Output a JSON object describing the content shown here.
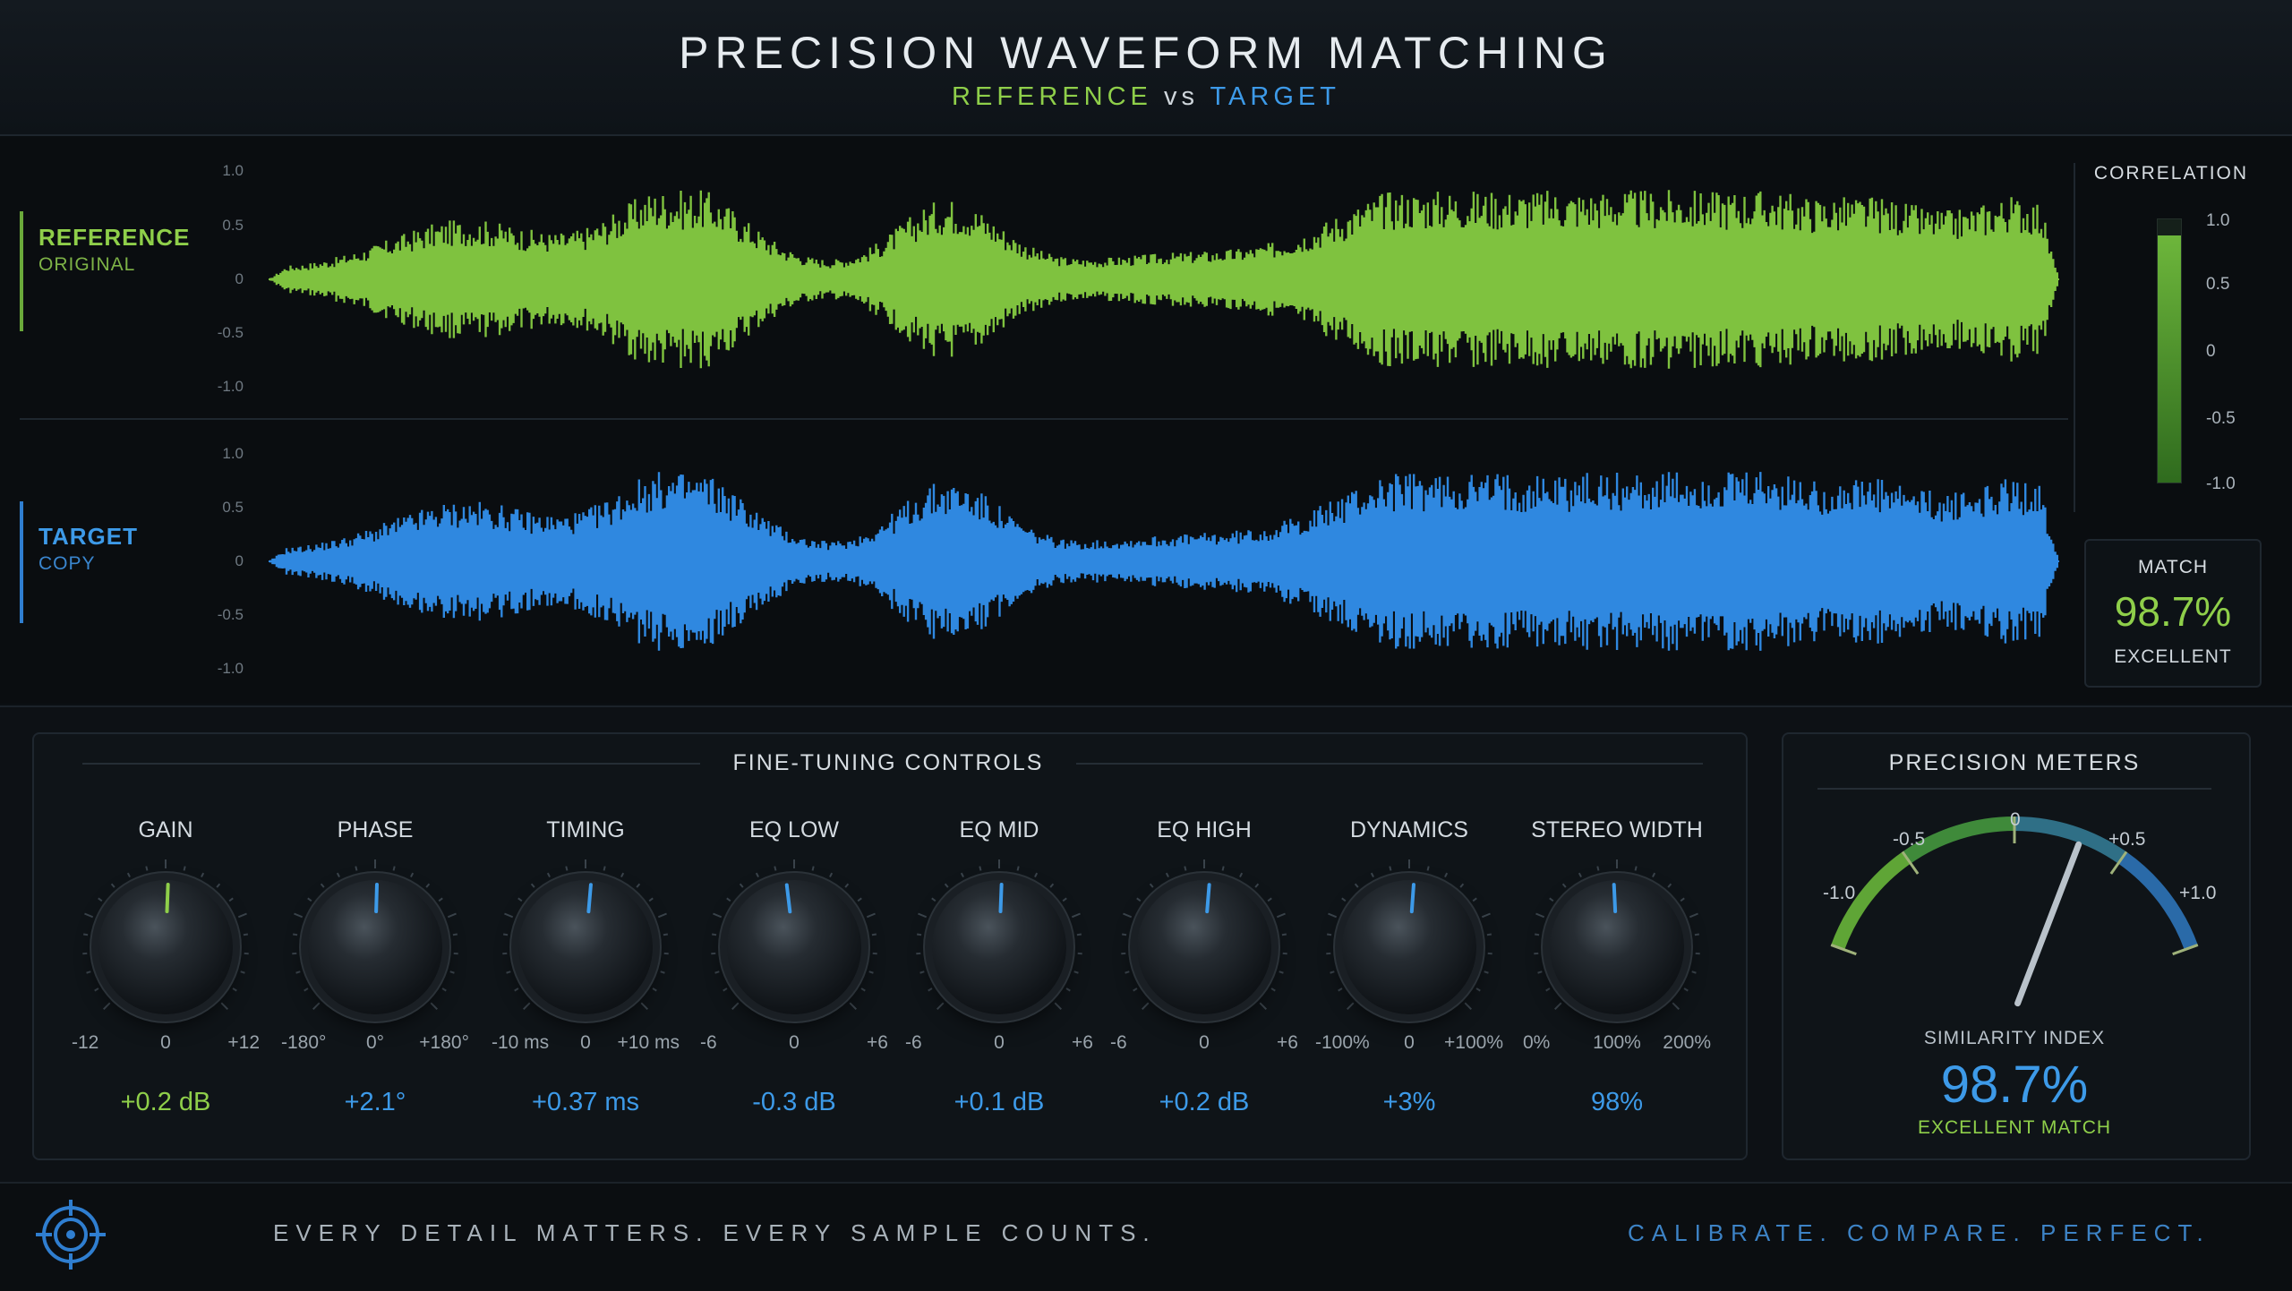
{
  "header": {
    "title": "PRECISION WAVEFORM MATCHING",
    "subtitle_reference": "REFERENCE",
    "subtitle_vs": "vs",
    "subtitle_target": "TARGET"
  },
  "tracks": [
    {
      "name": "REFERENCE",
      "sub": "ORIGINAL",
      "color": "#7fc23f"
    },
    {
      "name": "TARGET",
      "sub": "COPY",
      "color": "#2f88e0"
    }
  ],
  "amplitude_axis": [
    "1.0",
    "0.5",
    "0",
    "-0.5",
    "-1.0"
  ],
  "correlation": {
    "title": "CORRELATION",
    "ticks": [
      "1.0",
      "0.5",
      "0",
      "-0.5",
      "-1.0"
    ],
    "value": 0.88
  },
  "match": {
    "label": "MATCH",
    "value": "98.7%",
    "grade": "EXCELLENT"
  },
  "controls": {
    "title": "FINE-TUNING CONTROLS",
    "knobs": [
      {
        "label": "GAIN",
        "min": "-12",
        "mid": "0",
        "max": "+12",
        "value": "+0.2 dB",
        "level": 0.508,
        "color": "#8fcf4a"
      },
      {
        "label": "PHASE",
        "min": "-180°",
        "mid": "0°",
        "max": "+180°",
        "value": "+2.1°",
        "level": 0.506,
        "color": "#3d9ae8"
      },
      {
        "label": "TIMING",
        "min": "-10 ms",
        "mid": "0",
        "max": "+10 ms",
        "value": "+0.37 ms",
        "level": 0.518,
        "color": "#3d9ae8"
      },
      {
        "label": "EQ LOW",
        "min": "-6",
        "mid": "0",
        "max": "+6",
        "value": "-0.3 dB",
        "level": 0.475,
        "color": "#3d9ae8"
      },
      {
        "label": "EQ MID",
        "min": "-6",
        "mid": "0",
        "max": "+6",
        "value": "+0.1 dB",
        "level": 0.508,
        "color": "#3d9ae8"
      },
      {
        "label": "EQ HIGH",
        "min": "-6",
        "mid": "0",
        "max": "+6",
        "value": "+0.2 dB",
        "level": 0.517,
        "color": "#3d9ae8"
      },
      {
        "label": "DYNAMICS",
        "min": "-100%",
        "mid": "0",
        "max": "+100%",
        "value": "+3%",
        "level": 0.515,
        "color": "#3d9ae8"
      },
      {
        "label": "STEREO WIDTH",
        "min": "0%",
        "mid": "100%",
        "max": "200%",
        "value": "98%",
        "level": 0.49,
        "color": "#3d9ae8"
      }
    ]
  },
  "meters": {
    "title": "PRECISION METERS",
    "ticks": [
      "-1.0",
      "-0.5",
      "0",
      "+0.5",
      "+1.0"
    ],
    "needle_value": 0.3,
    "similarity_label": "SIMILARITY INDEX",
    "similarity_value": "98.7%",
    "similarity_grade": "EXCELLENT MATCH"
  },
  "footer": {
    "tagline_left": "EVERY DETAIL MATTERS. EVERY SAMPLE COUNTS.",
    "tagline_right": "CALIBRATE. COMPARE. PERFECT.",
    "logo_icon": "crosshair-target-icon"
  }
}
